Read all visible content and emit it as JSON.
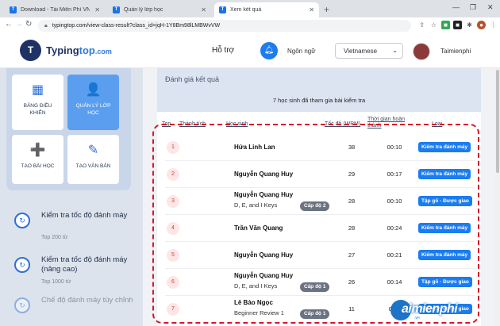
{
  "browser": {
    "tabs": [
      {
        "label": "Download - Tải Miễn Phí VN - Ph",
        "active": false
      },
      {
        "label": "Quản lý lớp học",
        "active": false
      },
      {
        "label": "Xem kết quả",
        "active": true
      }
    ],
    "url": "typingtop.com/view-class-result?class_id=jqH-1Y8Bm98lLMBWvVW",
    "window_controls": [
      "—",
      "❐",
      "✕"
    ]
  },
  "header": {
    "logo_mark": "T",
    "logo_name": "Typing",
    "logo_top": "top",
    "logo_domain": ".com",
    "support": "Hỗ trợ",
    "language_label": "Ngôn ngữ",
    "language_value": "Vietnamese",
    "username": "Taimienphi"
  },
  "sidebar": {
    "cards": [
      {
        "label": "BẢNG ĐIỀU KHIỂN",
        "icon": "grid-icon",
        "glyph": "▦",
        "selected": false
      },
      {
        "label": "QUẢN LÝ LỚP HỌC",
        "icon": "user-settings-icon",
        "glyph": "👤",
        "selected": true
      },
      {
        "label": "TẠO BÀI HỌC",
        "icon": "add-lesson-icon",
        "glyph": "➕",
        "selected": false
      },
      {
        "label": "TẠO VĂN BẢN",
        "icon": "edit-icon",
        "glyph": "✎",
        "selected": false
      }
    ],
    "items": [
      {
        "title": "Kiểm tra tốc độ đánh máy",
        "sub": "Top 200 từ"
      },
      {
        "title": "Kiểm tra tốc độ đánh máy (nâng cao)",
        "sub": "Top 1000 từ"
      },
      {
        "title": "Chế độ đánh máy tùy chỉnh",
        "sub": ""
      }
    ]
  },
  "results": {
    "title": "Đánh giá kết quả",
    "count_text": "7 học sinh đã tham gia bài kiểm tra",
    "columns": {
      "top": "Top",
      "achievement": "Thành tích",
      "student": "Học sinh",
      "speed": "Tốc độ (WPM)",
      "time": "Thời gian hoàn thành",
      "type": "Loại"
    },
    "rows": [
      {
        "rank": "1",
        "name": "Hứa Linh Lan",
        "sub": "",
        "level": "",
        "speed": "38",
        "time": "00:10",
        "type": "Kiểm tra đánh máy"
      },
      {
        "rank": "2",
        "name": "Nguyễn Quang Huy",
        "sub": "",
        "level": "",
        "speed": "29",
        "time": "00:17",
        "type": "Kiểm tra đánh máy"
      },
      {
        "rank": "3",
        "name": "Nguyễn Quang Huy",
        "sub": "D, E, and I Keys",
        "level": "Cấp độ 2",
        "speed": "28",
        "time": "00:10",
        "type": "Tập gõ - Được giao"
      },
      {
        "rank": "4",
        "name": "Trần Văn Quang",
        "sub": "",
        "level": "",
        "speed": "28",
        "time": "00:24",
        "type": "Kiểm tra đánh máy"
      },
      {
        "rank": "5",
        "name": "Nguyễn Quang Huy",
        "sub": "",
        "level": "",
        "speed": "27",
        "time": "00:21",
        "type": "Kiểm tra đánh máy"
      },
      {
        "rank": "6",
        "name": "Nguyễn Quang Huy",
        "sub": "D, E, and I Keys",
        "level": "Cấp độ 1",
        "speed": "26",
        "time": "00:14",
        "type": "Tập gõ - Được giao"
      },
      {
        "rank": "7",
        "name": "Lê Bảo Ngọc",
        "sub": "Beginner Review 1",
        "level": "Cấp độ 1",
        "speed": "11",
        "time": "01:1",
        "type": "Tập gõ - Được giao"
      }
    ]
  },
  "watermark": {
    "text": "aimienphi",
    "sub": ".vn"
  }
}
